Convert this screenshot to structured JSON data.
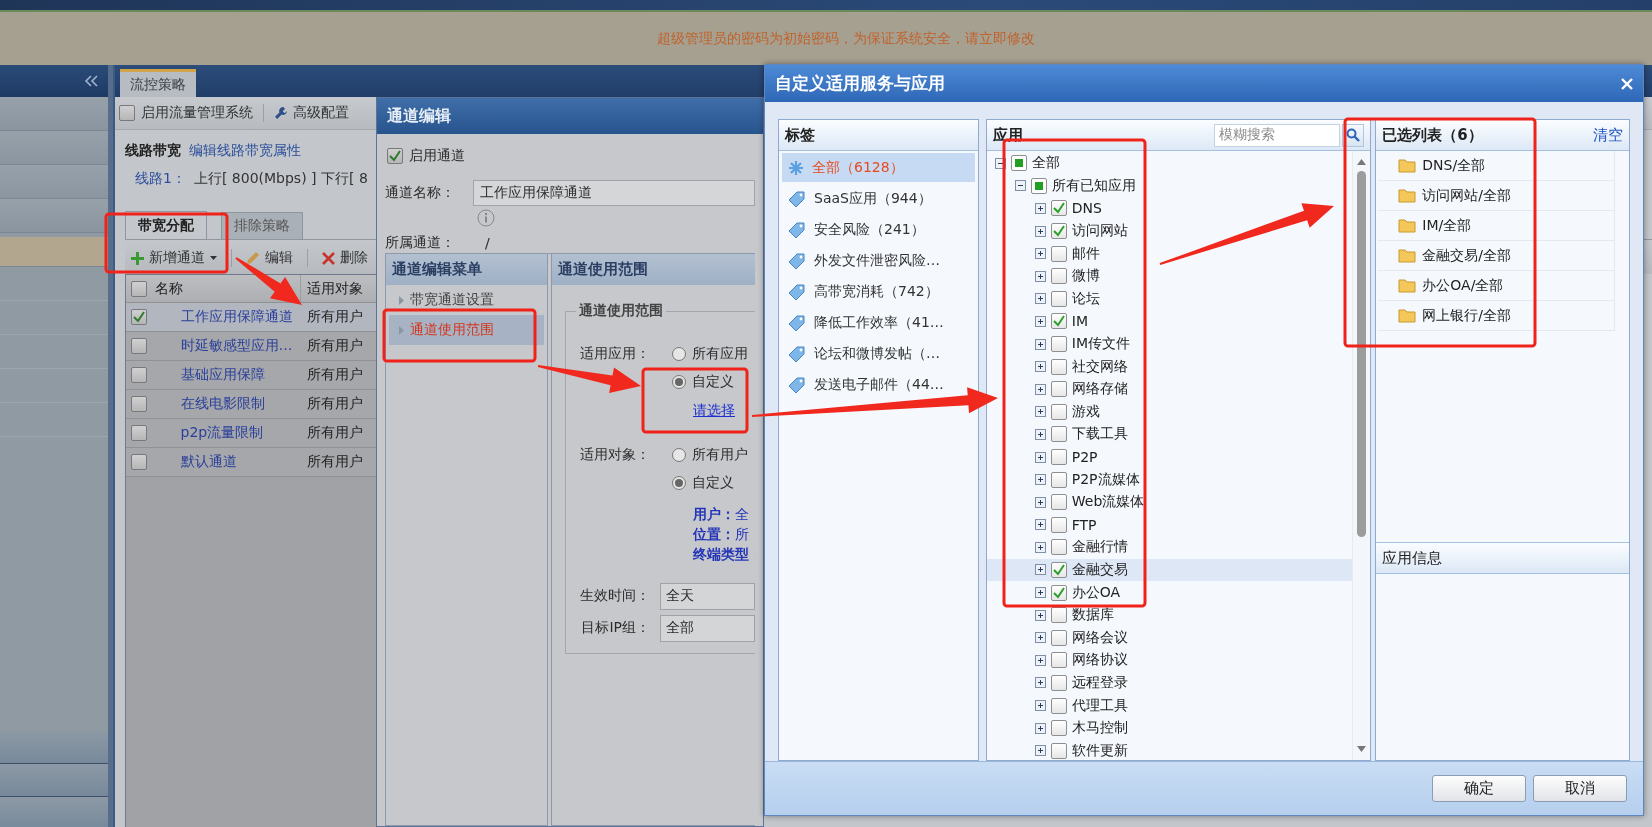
{
  "banner": {
    "text": "超级管理员的密码为初始密码，为保证系统安全，请立即修改"
  },
  "main_tabs": [
    {
      "label": "流控策略",
      "selected": true
    }
  ],
  "toolbar": {
    "enable": {
      "label": "启用流量管理系统",
      "checked": false
    },
    "advanced": "高级配置"
  },
  "line": {
    "title": "线路带宽",
    "edit_link": "编辑线路带宽属性",
    "label": "线路1：",
    "value": "上行[ 800(Mbps) ] 下行[ 8"
  },
  "sub_tabs": [
    {
      "label": "带宽分配",
      "selected": true
    },
    {
      "label": "排除策略",
      "selected": false
    }
  ],
  "actions": [
    {
      "kind": "add",
      "label": "新增通道",
      "dropdown": true
    },
    {
      "kind": "edit",
      "label": "编辑",
      "dropdown": false
    },
    {
      "kind": "delete",
      "label": "删除",
      "dropdown": false
    }
  ],
  "table": {
    "select_all": false,
    "columns": [
      "名称",
      "适用对象"
    ],
    "rows": [
      {
        "name": "工作应用保障通道",
        "target": "所有用户",
        "checked": true,
        "selected": true
      },
      {
        "name": "时延敏感型应用…",
        "target": "所有用户",
        "checked": false,
        "selected": false
      },
      {
        "name": "基础应用保障",
        "target": "所有用户",
        "checked": false,
        "selected": false
      },
      {
        "name": "在线电影限制",
        "target": "所有用户",
        "checked": false,
        "selected": false
      },
      {
        "name": "p2p流量限制",
        "target": "所有用户",
        "checked": false,
        "selected": false
      },
      {
        "name": "默认通道",
        "target": "所有用户",
        "checked": false,
        "selected": false
      }
    ]
  },
  "edit_dialog": {
    "title": "通道编辑",
    "enable": {
      "label": "启用通道",
      "checked": true
    },
    "name_label": "通道名称：",
    "name_value": "工作应用保障通道",
    "parent_label": "所属通道：",
    "parent_value": "/",
    "menu": {
      "title": "通道编辑菜单",
      "items": [
        {
          "label": "带宽通道设置",
          "selected": false
        },
        {
          "label": "通道使用范围",
          "selected": true
        }
      ]
    },
    "scope": {
      "title": "通道使用范围",
      "legend": "通道使用范围",
      "fields": [
        {
          "kind": "radio",
          "label": "适用应用：",
          "options": [
            {
              "label": "所有应用",
              "selected": false
            },
            {
              "label": "自定义",
              "selected": true
            }
          ],
          "link": "请选择"
        },
        {
          "kind": "radio",
          "label": "适用对象：",
          "options": [
            {
              "label": "所有用户",
              "selected": false
            },
            {
              "label": "自定义",
              "selected": true
            }
          ],
          "details": [
            {
              "key": "用户：",
              "value": "全"
            },
            {
              "key": "位置：",
              "value": "所"
            },
            {
              "key": "终端类型："
            }
          ]
        },
        {
          "kind": "select",
          "label": "生效时间：",
          "value": "全天"
        },
        {
          "kind": "select",
          "label": "目标IP组：",
          "value": "全部"
        }
      ]
    }
  },
  "app_dialog": {
    "title": "自定义适用服务与应用",
    "tags": {
      "title": "标签",
      "items": [
        {
          "kind": "all",
          "label": "全部（6128）",
          "selected": true
        },
        {
          "kind": "tag",
          "label": "SaaS应用（944）",
          "selected": false
        },
        {
          "kind": "tag",
          "label": "安全风险（241）",
          "selected": false
        },
        {
          "kind": "tag",
          "label": "外发文件泄密风险…",
          "selected": false
        },
        {
          "kind": "tag",
          "label": "高带宽消耗（742）",
          "selected": false
        },
        {
          "kind": "tag",
          "label": "降低工作效率（41…",
          "selected": false
        },
        {
          "kind": "tag",
          "label": "论坛和微博发帖（…",
          "selected": false
        },
        {
          "kind": "tag",
          "label": "发送电子邮件（44…",
          "selected": false
        }
      ]
    },
    "apps": {
      "title": "应用",
      "search_placeholder": "模糊搜索",
      "tree": [
        {
          "label": "全部",
          "checked": false,
          "partial": true,
          "expanded": true,
          "selected": false,
          "children": [
            {
              "label": "所有已知应用",
              "checked": false,
              "partial": true,
              "expanded": true,
              "selected": false,
              "children": [
                {
                  "label": "DNS",
                  "checked": true,
                  "partial": false,
                  "expanded": false,
                  "selected": false
                },
                {
                  "label": "访问网站",
                  "checked": true,
                  "partial": false,
                  "expanded": false,
                  "selected": false
                },
                {
                  "label": "邮件",
                  "checked": false,
                  "partial": false,
                  "expanded": false,
                  "selected": false
                },
                {
                  "label": "微博",
                  "checked": false,
                  "partial": false,
                  "expanded": false,
                  "selected": false
                },
                {
                  "label": "论坛",
                  "checked": false,
                  "partial": false,
                  "expanded": false,
                  "selected": false
                },
                {
                  "label": "IM",
                  "checked": true,
                  "partial": false,
                  "expanded": false,
                  "selected": false
                },
                {
                  "label": "IM传文件",
                  "checked": false,
                  "partial": false,
                  "expanded": false,
                  "selected": false
                },
                {
                  "label": "社交网络",
                  "checked": false,
                  "partial": false,
                  "expanded": false,
                  "selected": false
                },
                {
                  "label": "网络存储",
                  "checked": false,
                  "partial": false,
                  "expanded": false,
                  "selected": false
                },
                {
                  "label": "游戏",
                  "checked": false,
                  "partial": false,
                  "expanded": false,
                  "selected": false
                },
                {
                  "label": "下载工具",
                  "checked": false,
                  "partial": false,
                  "expanded": false,
                  "selected": false
                },
                {
                  "label": "P2P",
                  "checked": false,
                  "partial": false,
                  "expanded": false,
                  "selected": false
                },
                {
                  "label": "P2P流媒体",
                  "checked": false,
                  "partial": false,
                  "expanded": false,
                  "selected": false
                },
                {
                  "label": "Web流媒体",
                  "checked": false,
                  "partial": false,
                  "expanded": false,
                  "selected": false
                },
                {
                  "label": "FTP",
                  "checked": false,
                  "partial": false,
                  "expanded": false,
                  "selected": false
                },
                {
                  "label": "金融行情",
                  "checked": false,
                  "partial": false,
                  "expanded": false,
                  "selected": false
                },
                {
                  "label": "金融交易",
                  "checked": true,
                  "partial": false,
                  "expanded": false,
                  "selected": true
                },
                {
                  "label": "办公OA",
                  "checked": true,
                  "partial": false,
                  "expanded": false,
                  "selected": false
                },
                {
                  "label": "数据库",
                  "checked": false,
                  "partial": false,
                  "expanded": false,
                  "selected": false
                },
                {
                  "label": "网络会议",
                  "checked": false,
                  "partial": false,
                  "expanded": false,
                  "selected": false
                },
                {
                  "label": "网络协议",
                  "checked": false,
                  "partial": false,
                  "expanded": false,
                  "selected": false
                },
                {
                  "label": "远程登录",
                  "checked": false,
                  "partial": false,
                  "expanded": false,
                  "selected": false
                },
                {
                  "label": "代理工具",
                  "checked": false,
                  "partial": false,
                  "expanded": false,
                  "selected": false
                },
                {
                  "label": "木马控制",
                  "checked": false,
                  "partial": false,
                  "expanded": false,
                  "selected": false
                },
                {
                  "label": "软件更新",
                  "checked": false,
                  "partial": false,
                  "expanded": false,
                  "selected": false
                }
              ]
            }
          ]
        }
      ]
    },
    "selected": {
      "title": "已选列表（6）",
      "clear": "清空",
      "items": [
        "DNS/全部",
        "访问网站/全部",
        "IM/全部",
        "金融交易/全部",
        "办公OA/全部",
        "网上银行/全部"
      ]
    },
    "info": {
      "title": "应用信息"
    },
    "buttons": [
      "确定",
      "取消"
    ]
  }
}
